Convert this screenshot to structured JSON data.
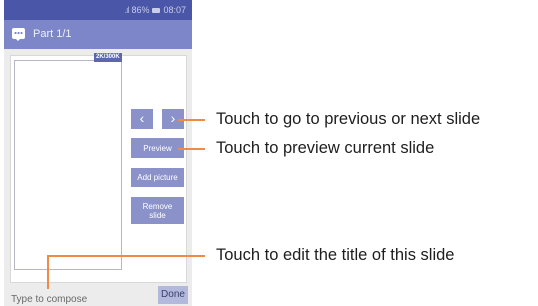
{
  "status_bar": {
    "battery_percent": "86%",
    "time": "08:07"
  },
  "app_bar": {
    "title": "Part 1/1",
    "icon": "message-icon"
  },
  "slide": {
    "size_badge": "2K/300K"
  },
  "buttons": {
    "prev": "‹",
    "next": "›",
    "preview": "Preview",
    "add_picture": "Add picture",
    "remove_slide_line1": "Remove",
    "remove_slide_line2": "slide",
    "done": "Done"
  },
  "compose": {
    "placeholder": "Type to compose"
  },
  "callouts": {
    "navigate": "Touch to go to previous or next slide",
    "preview": "Touch to preview current slide",
    "edit_title": "Touch to edit the title of this slide"
  },
  "colors": {
    "status_bar": "#4a56a8",
    "app_bar": "#7c86c9",
    "button": "#8a92c9",
    "done_button": "#b3b8dd",
    "callout_line": "#f08a45"
  }
}
